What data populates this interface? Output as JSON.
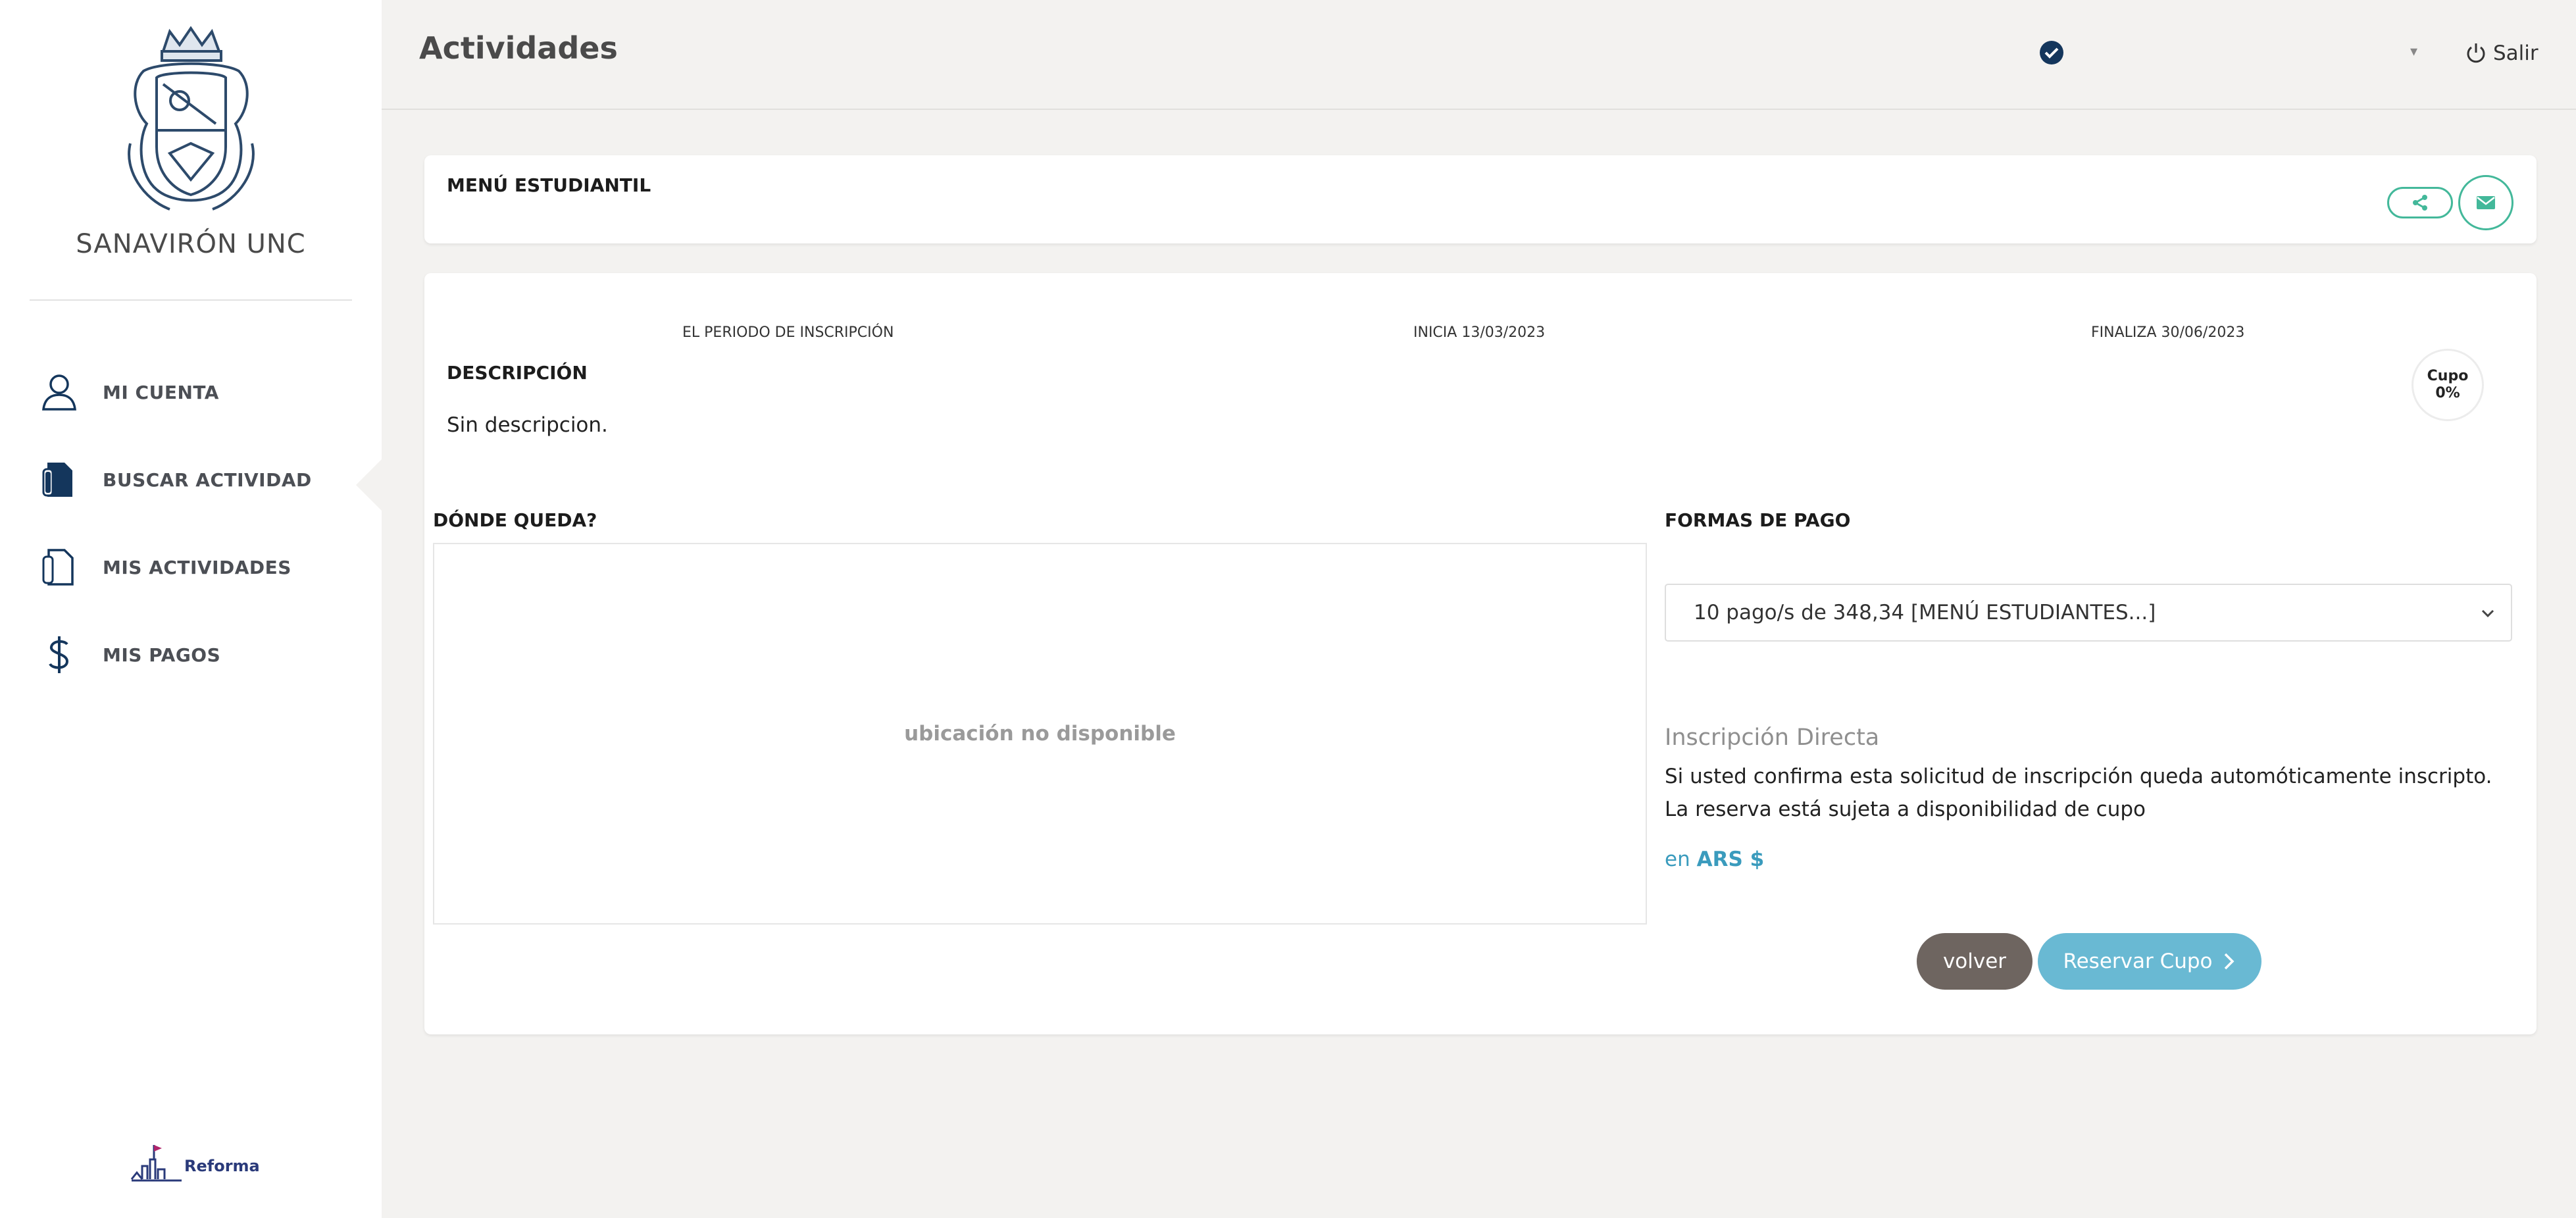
{
  "sidebar": {
    "brand": "SANAVIRÓN UNC",
    "items": [
      {
        "label": "MI CUENTA",
        "icon": "user-icon"
      },
      {
        "label": "BUSCAR ACTIVIDAD",
        "icon": "document-search-icon",
        "active": true
      },
      {
        "label": "MIS ACTIVIDADES",
        "icon": "documents-icon"
      },
      {
        "label": "MIS PAGOS",
        "icon": "dollar-icon"
      }
    ],
    "footer_logo_text": "Reforma"
  },
  "header": {
    "title": "Actividades",
    "logout_label": "Salir",
    "caret": "▾"
  },
  "activity": {
    "title": "MENÚ ESTUDIANTIL",
    "period_label": "EL PERIODO DE INSCRIPCIÓN",
    "start": "INICIA 13/03/2023",
    "end": "FINALIZA 30/06/2023",
    "cupo_label": "Cupo",
    "cupo_value": "0%",
    "description_heading": "DESCRIPCIÓN",
    "description": "Sin descripcion.",
    "location_heading": "DÓNDE QUEDA?",
    "location_placeholder": "ubicación no disponible",
    "payment_heading": "FORMAS DE PAGO",
    "payment_selected": "10 pago/s de 348,34 [MENÚ ESTUDIANTES...]",
    "enrollment_title": "Inscripción Directa",
    "enrollment_text": "Si usted confirma esta solicitud de inscripción queda automóticamente inscripto. La reserva está sujeta a disponibilidad de cupo",
    "currency_prefix": "en",
    "currency": "ARS $",
    "back_button": "volver",
    "reserve_button": "Reservar Cupo"
  },
  "colors": {
    "accent": "#43b89a",
    "reserve": "#69b9d3",
    "back": "#6e6560",
    "currency": "#3a9bbd",
    "icon": "#14365c"
  }
}
